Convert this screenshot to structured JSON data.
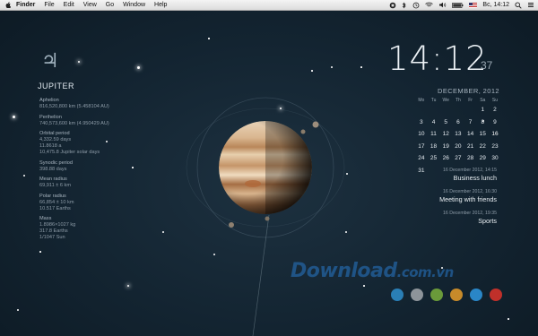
{
  "menubar": {
    "app": "Finder",
    "items": [
      "File",
      "Edit",
      "View",
      "Go",
      "Window",
      "Help"
    ],
    "clock": "Вс, 14:12"
  },
  "planet": {
    "symbol": "♃",
    "name": "JUPITER",
    "stats": [
      {
        "label": "Aphelion",
        "lines": [
          "816,520,800 km (5.458104 AU)"
        ]
      },
      {
        "label": "Perihelion",
        "lines": [
          "740,573,600 km (4.950429 AU)"
        ]
      },
      {
        "label": "Orbital period",
        "lines": [
          "4,332.59 days",
          "11.8618 a",
          "10,475.8 Jupiter solar days"
        ]
      },
      {
        "label": "Synodic period",
        "lines": [
          "398.88 days"
        ]
      },
      {
        "label": "Mean radius",
        "lines": [
          "69,911 ± 6 km"
        ]
      },
      {
        "label": "Polar radius",
        "lines": [
          "66,854 ± 10 km",
          "10.517 Earths"
        ]
      },
      {
        "label": "Mass",
        "lines": [
          "1.8986×1027 kg",
          "317.8 Earths",
          "1/1047 Sun"
        ]
      }
    ]
  },
  "clock": {
    "time": "14:12",
    "seconds": "37"
  },
  "calendar": {
    "title": "DECEMBER, 2012",
    "weekdays": [
      "Mo",
      "Tu",
      "We",
      "Th",
      "Fr",
      "Sa",
      "Su"
    ],
    "weeks": [
      [
        "",
        "",
        "",
        "",
        "",
        "1",
        "2"
      ],
      [
        "3",
        "4",
        "5",
        "6",
        "7",
        "8",
        "9"
      ],
      [
        "10",
        "11",
        "12",
        "13",
        "14",
        "15",
        "16"
      ],
      [
        "17",
        "18",
        "19",
        "20",
        "21",
        "22",
        "23"
      ],
      [
        "24",
        "25",
        "26",
        "27",
        "28",
        "29",
        "30"
      ],
      [
        "31",
        "",
        "",
        "",
        "",
        "",
        ""
      ]
    ]
  },
  "events": [
    {
      "date": "16 December 2012, 14:15",
      "title": "Business lunch"
    },
    {
      "date": "16 December 2012, 16:30",
      "title": "Meeting with friends"
    },
    {
      "date": "16 December 2012, 19:35",
      "title": "Sports"
    }
  ],
  "watermark": {
    "main": "Download",
    "suffix": ".com.vn"
  },
  "themes": [
    "#2a7fb6",
    "#8d949a",
    "#6a9a3a",
    "#c78a2a",
    "#2a86c7",
    "#c0302a"
  ]
}
